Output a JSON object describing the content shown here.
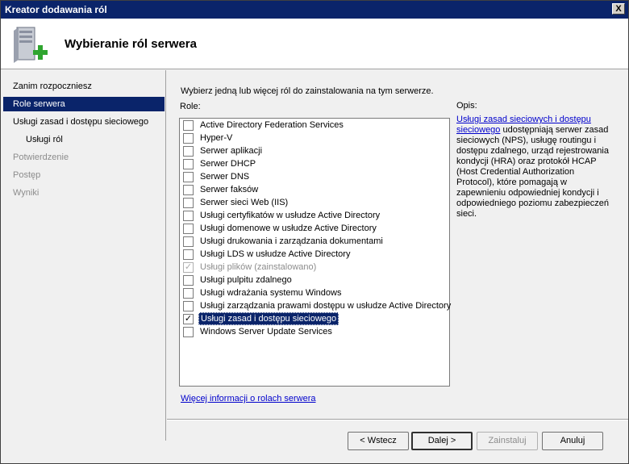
{
  "window": {
    "title": "Kreator dodawania ról",
    "close_label": "X"
  },
  "header": {
    "title": "Wybieranie ról serwera"
  },
  "nav": [
    {
      "label": "Zanim rozpoczniesz",
      "state": "normal",
      "level": 0
    },
    {
      "label": "Role serwera",
      "state": "active",
      "level": 0
    },
    {
      "label": "Usługi zasad i dostępu sieciowego",
      "state": "normal",
      "level": 0
    },
    {
      "label": "Usługi ról",
      "state": "normal",
      "level": 1
    },
    {
      "label": "Potwierdzenie",
      "state": "disabled",
      "level": 0
    },
    {
      "label": "Postęp",
      "state": "disabled",
      "level": 0
    },
    {
      "label": "Wyniki",
      "state": "disabled",
      "level": 0
    }
  ],
  "main": {
    "instruction": "Wybierz jedną lub więcej ról do zainstalowania na tym serwerze.",
    "roles_label": "Role:",
    "roles": [
      {
        "label": "Active Directory Federation Services",
        "checked": false,
        "disabled": false,
        "selected": false
      },
      {
        "label": "Hyper-V",
        "checked": false,
        "disabled": false,
        "selected": false
      },
      {
        "label": "Serwer aplikacji",
        "checked": false,
        "disabled": false,
        "selected": false
      },
      {
        "label": "Serwer DHCP",
        "checked": false,
        "disabled": false,
        "selected": false
      },
      {
        "label": "Serwer DNS",
        "checked": false,
        "disabled": false,
        "selected": false
      },
      {
        "label": "Serwer faksów",
        "checked": false,
        "disabled": false,
        "selected": false
      },
      {
        "label": "Serwer sieci Web (IIS)",
        "checked": false,
        "disabled": false,
        "selected": false
      },
      {
        "label": "Usługi certyfikatów w usłudze Active Directory",
        "checked": false,
        "disabled": false,
        "selected": false
      },
      {
        "label": "Usługi domenowe w usłudze Active Directory",
        "checked": false,
        "disabled": false,
        "selected": false
      },
      {
        "label": "Usługi drukowania i zarządzania dokumentami",
        "checked": false,
        "disabled": false,
        "selected": false
      },
      {
        "label": "Usługi LDS w usłudze Active Directory",
        "checked": false,
        "disabled": false,
        "selected": false
      },
      {
        "label": "Usługi plików  (zainstalowano)",
        "checked": true,
        "disabled": true,
        "selected": false
      },
      {
        "label": "Usługi pulpitu zdalnego",
        "checked": false,
        "disabled": false,
        "selected": false
      },
      {
        "label": "Usługi wdrażania systemu Windows",
        "checked": false,
        "disabled": false,
        "selected": false
      },
      {
        "label": "Usługi zarządzania prawami dostępu w usłudze Active Directory",
        "checked": false,
        "disabled": false,
        "selected": false
      },
      {
        "label": "Usługi zasad i dostępu sieciowego",
        "checked": true,
        "disabled": false,
        "selected": true
      },
      {
        "label": "Windows Server Update Services",
        "checked": false,
        "disabled": false,
        "selected": false
      }
    ],
    "description_title": "Opis:",
    "description_link": "Usługi zasad sieciowych i dostępu sieciowego",
    "description_text": " udostępniają serwer zasad sieciowych (NPS), usługę routingu i dostępu zdalnego, urząd rejestrowania kondycji (HRA) oraz protokół HCAP (Host Credential Authorization Protocol), które pomagają w zapewnieniu odpowiedniej kondycji i odpowiedniego poziomu zabezpieczeń sieci.",
    "more_info_link": "Więcej informacji o rolach serwera"
  },
  "buttons": {
    "back": "< Wstecz",
    "next": "Dalej >",
    "install": "Zainstaluj",
    "cancel": "Anuluj"
  },
  "icons": {
    "header_icon": "server-roles-add-icon",
    "check": "✓"
  }
}
